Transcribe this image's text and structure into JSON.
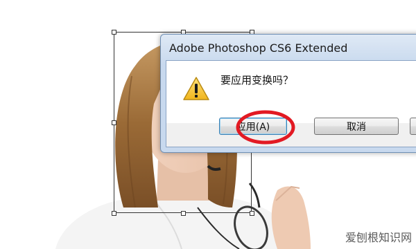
{
  "dialog": {
    "title": "Adobe Photoshop CS6 Extended",
    "message": "要应用变换吗？",
    "buttons": {
      "apply": "应用(A)",
      "cancel": "取消"
    }
  },
  "colors": {
    "annotation": "#e21a23",
    "warning": "#f1c232",
    "dialog_frame": "#c8d9ee",
    "default_button_border": "#3c7fb1"
  },
  "icons": {
    "dialog": "warning-icon",
    "annotation": "red-circle"
  },
  "watermark": "爱刨根知识网"
}
